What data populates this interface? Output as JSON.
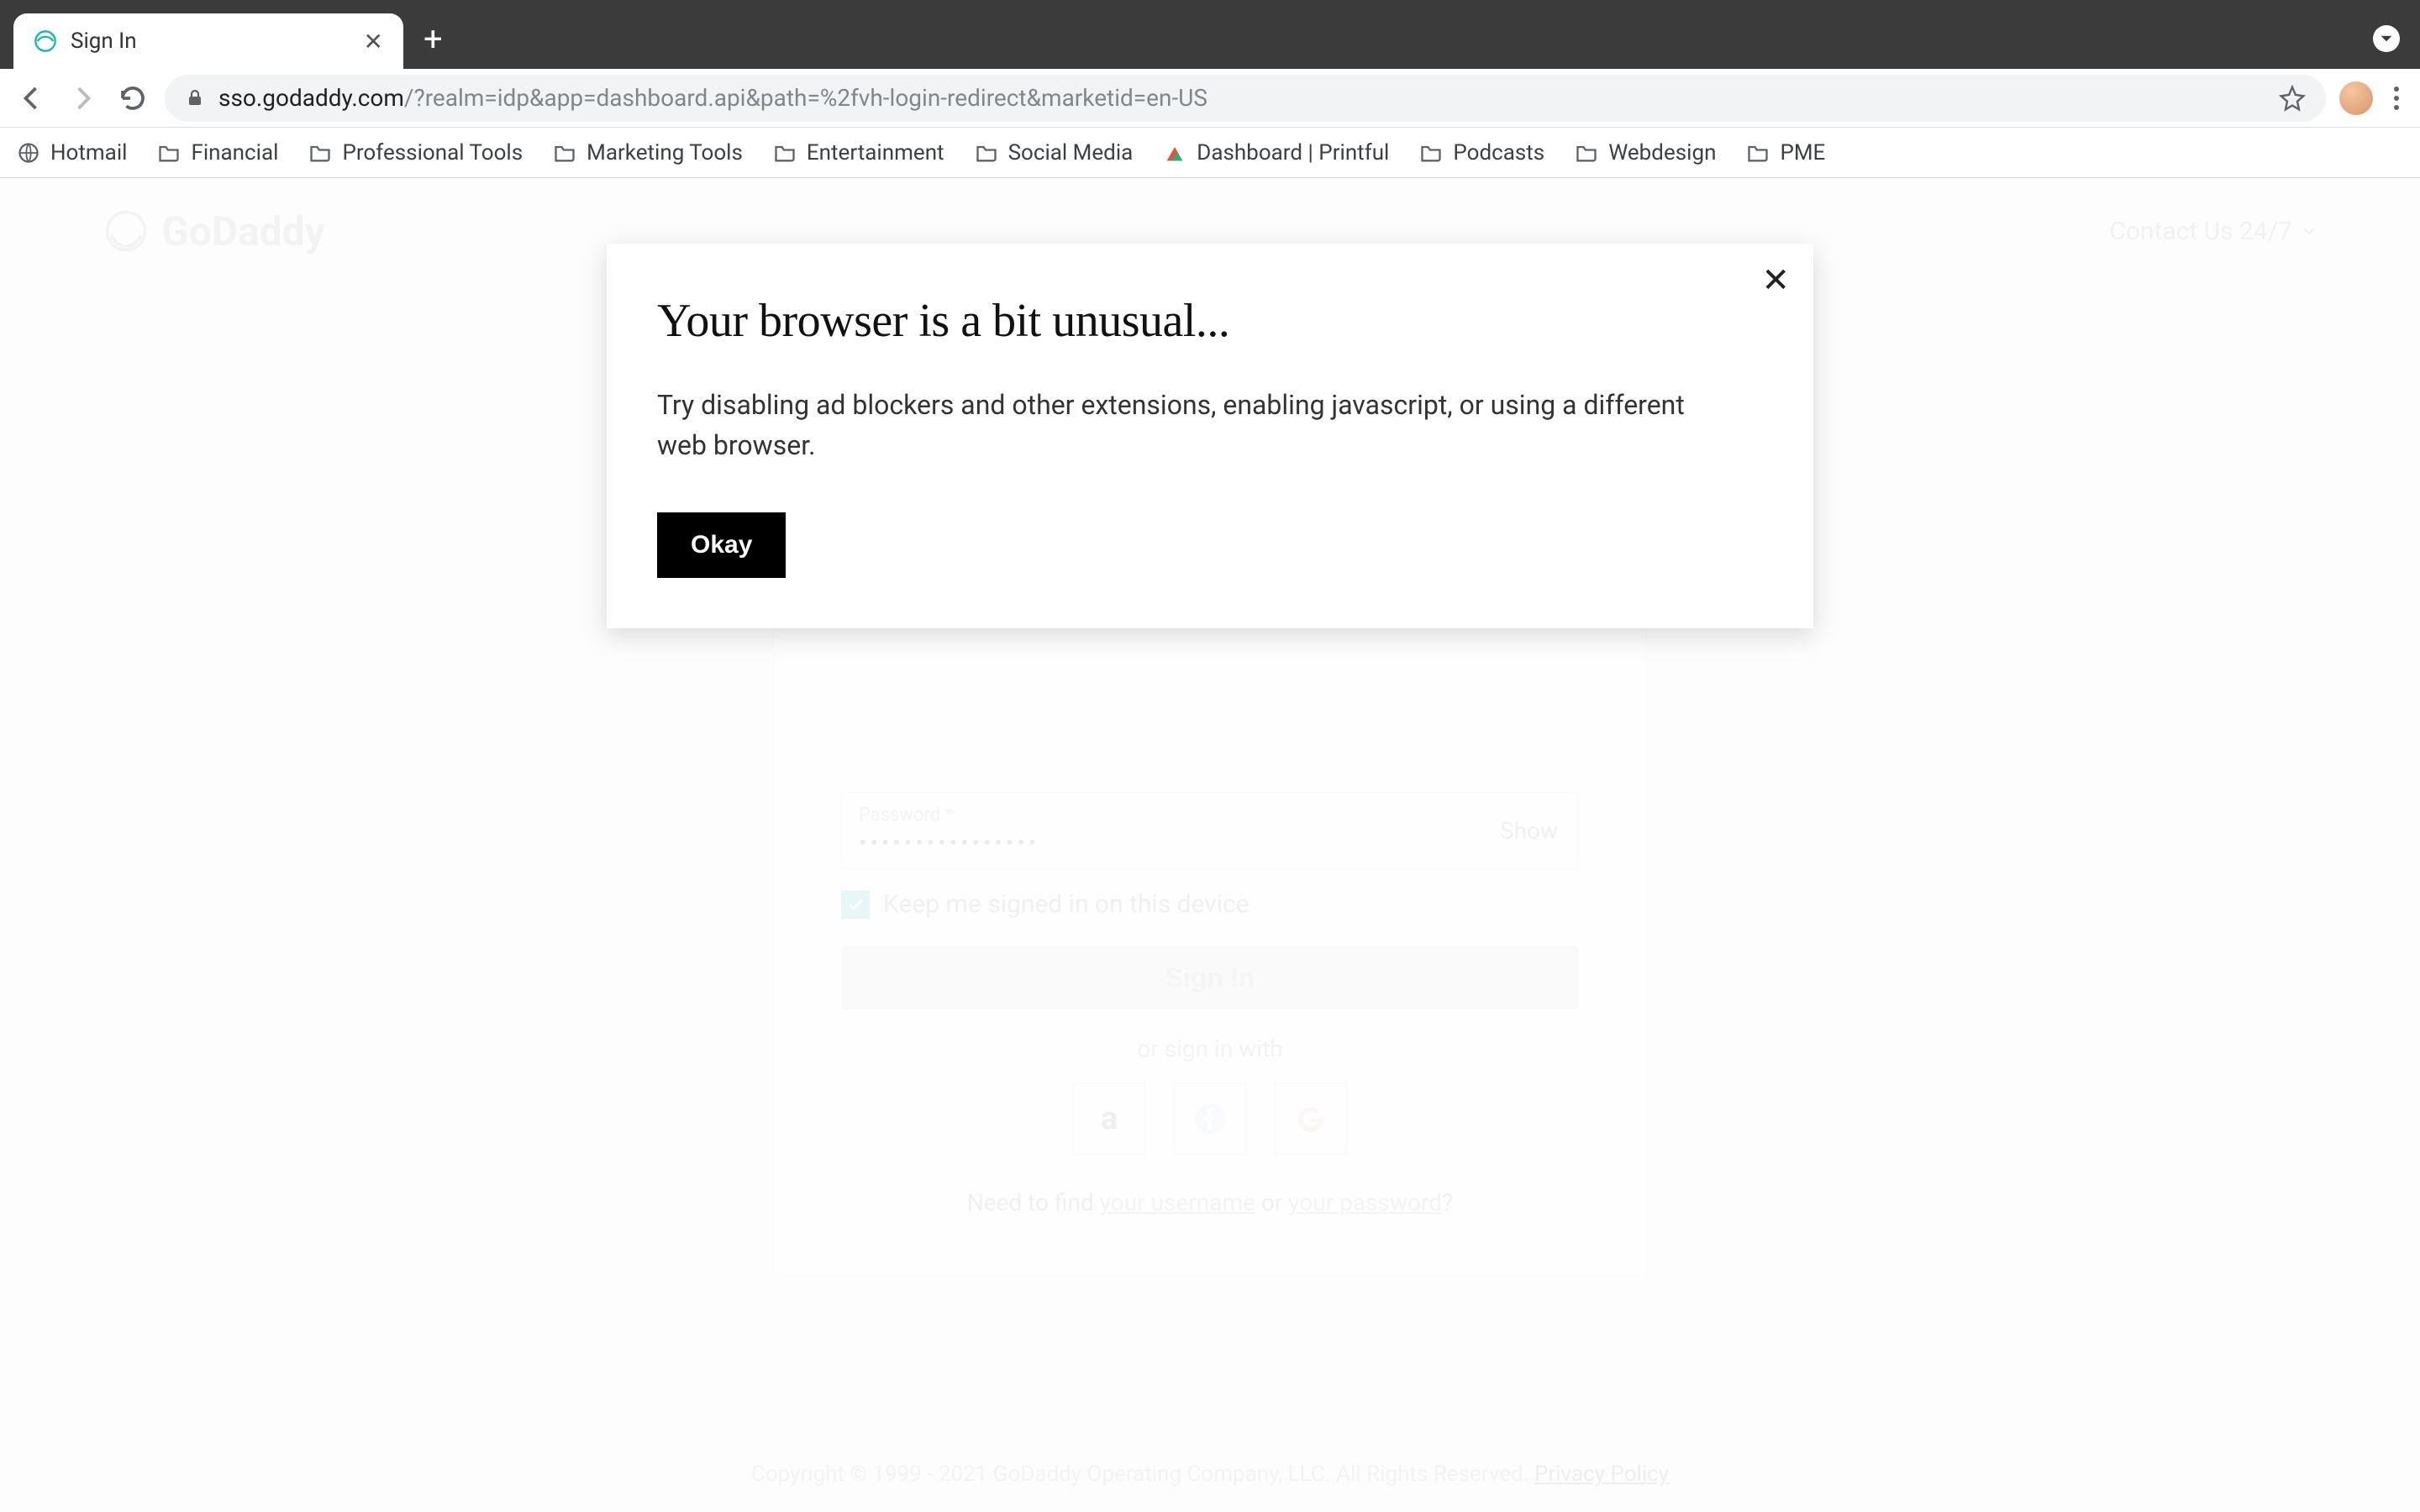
{
  "browser": {
    "tab_title": "Sign In",
    "url_secure": "sso.godaddy.com",
    "url_rest": "/?realm=idp&app=dashboard.api&path=%2fvh-login-redirect&marketid=en-US",
    "bookmarks": [
      {
        "kind": "globe",
        "label": "Hotmail"
      },
      {
        "kind": "folder",
        "label": "Financial"
      },
      {
        "kind": "folder",
        "label": "Professional Tools"
      },
      {
        "kind": "folder",
        "label": "Marketing Tools"
      },
      {
        "kind": "folder",
        "label": "Entertainment"
      },
      {
        "kind": "folder",
        "label": "Social Media"
      },
      {
        "kind": "printful",
        "label": "Dashboard | Printful"
      },
      {
        "kind": "folder",
        "label": "Podcasts"
      },
      {
        "kind": "folder",
        "label": "Webdesign"
      },
      {
        "kind": "folder",
        "label": "PME"
      }
    ]
  },
  "header": {
    "logo_text": "GoDaddy",
    "contact_label": "Contact Us 24/7"
  },
  "modal": {
    "title": "Your browser is a bit unusual...",
    "body": "Try disabling ad blockers and other extensions, enabling javascript, or using a different web browser.",
    "ok_label": "Okay"
  },
  "signin": {
    "password_label": "Password *",
    "password_value": "••••••••••••••••",
    "show_label": "Show",
    "remember_label": "Keep me signed in on this device",
    "submit_label": "Sign In",
    "or_label": "or sign in with",
    "find_prefix": "Need to find ",
    "find_username": "your username",
    "find_or": " or ",
    "find_password": "your password",
    "find_suffix": "?"
  },
  "footer": {
    "copyright": "Copyright © 1999 - 2021 GoDaddy Operating Company, LLC. All Rights Reserved. ",
    "privacy": "Privacy Policy"
  }
}
